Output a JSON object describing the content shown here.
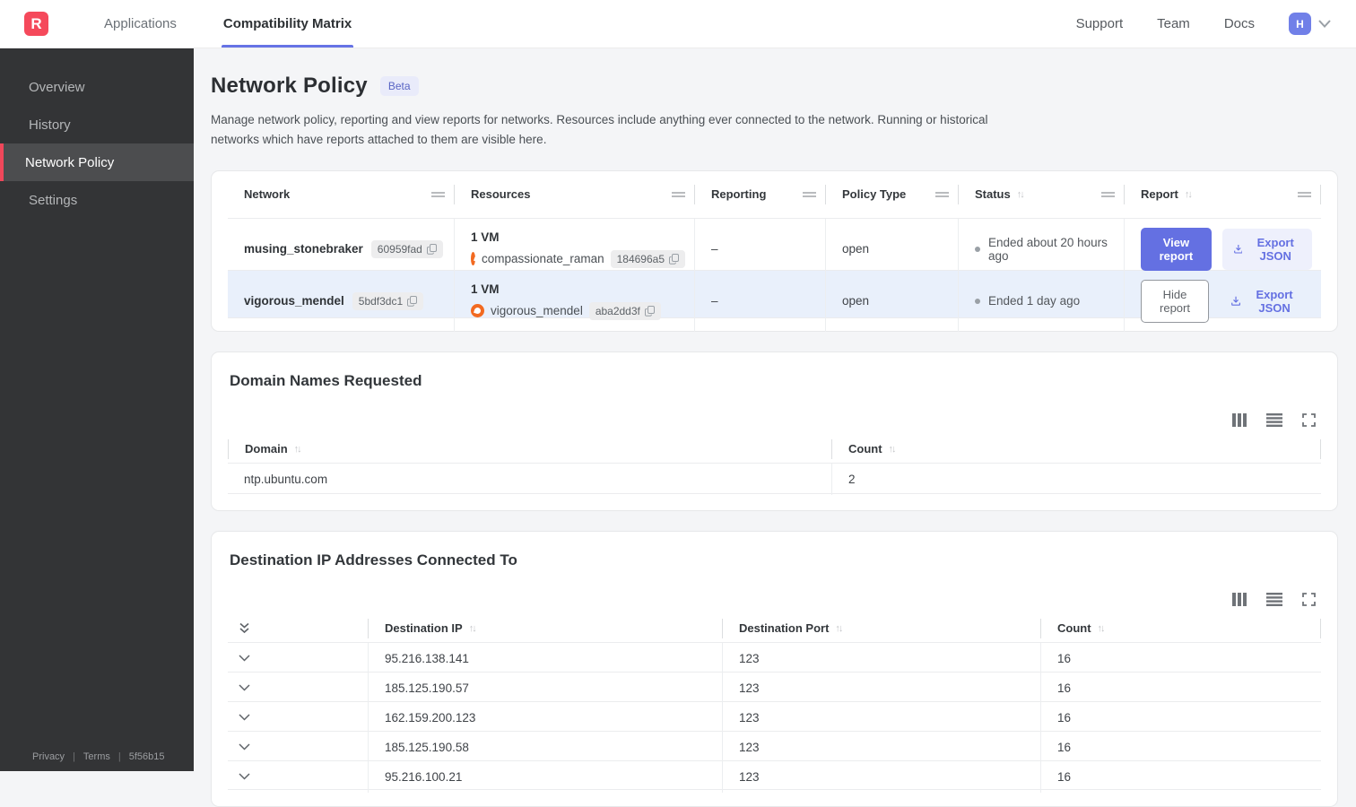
{
  "navbar": {
    "logo_letter": "R",
    "nav": [
      {
        "label": "Applications"
      },
      {
        "label": "Compatibility Matrix"
      }
    ],
    "links": {
      "support": "Support",
      "team": "Team",
      "docs": "Docs"
    },
    "avatar_initial": "H"
  },
  "sidebar": {
    "items": [
      {
        "label": "Overview"
      },
      {
        "label": "History"
      },
      {
        "label": "Network Policy"
      },
      {
        "label": "Settings"
      }
    ],
    "footer": {
      "privacy": "Privacy",
      "terms": "Terms",
      "version": "5f56b15"
    }
  },
  "page": {
    "title": "Network Policy",
    "beta_badge": "Beta",
    "description": "Manage network policy, reporting and view reports for networks. Resources include anything ever connected to the network. Running or historical networks which have reports attached to them are visible here."
  },
  "networks_table": {
    "columns": {
      "network": "Network",
      "resources": "Resources",
      "reporting": "Reporting",
      "policy_type": "Policy Type",
      "status": "Status",
      "report": "Report"
    },
    "rows": [
      {
        "network_name": "musing_stonebraker",
        "network_id": "60959fad",
        "resources_summary": "1 VM",
        "resource_name": "compassionate_raman",
        "resource_id": "184696a5",
        "reporting": "–",
        "policy_type": "open",
        "status": "Ended about 20 hours ago",
        "report_button": "View report",
        "export_label": "Export JSON"
      },
      {
        "network_name": "vigorous_mendel",
        "network_id": "5bdf3dc1",
        "resources_summary": "1 VM",
        "resource_name": "vigorous_mendel",
        "resource_id": "aba2dd3f",
        "reporting": "–",
        "policy_type": "open",
        "status": "Ended 1 day ago",
        "report_button": "Hide report",
        "export_label": "Export JSON"
      }
    ]
  },
  "domains_card": {
    "title": "Domain Names Requested",
    "columns": {
      "domain": "Domain",
      "count": "Count"
    },
    "rows": [
      {
        "domain": "ntp.ubuntu.com",
        "count": "2"
      }
    ]
  },
  "destinations_card": {
    "title": "Destination IP Addresses Connected To",
    "columns": {
      "ip": "Destination IP",
      "port": "Destination Port",
      "count": "Count"
    },
    "rows": [
      {
        "ip": "95.216.138.141",
        "port": "123",
        "count": "16"
      },
      {
        "ip": "185.125.190.57",
        "port": "123",
        "count": "16"
      },
      {
        "ip": "162.159.200.123",
        "port": "123",
        "count": "16"
      },
      {
        "ip": "185.125.190.58",
        "port": "123",
        "count": "16"
      },
      {
        "ip": "95.216.100.21",
        "port": "123",
        "count": "16"
      }
    ]
  },
  "colors": {
    "accent_indigo": "#6470e2",
    "brand_red": "#f5495b",
    "selected_row": "#e9f0fb",
    "sidebar_bg": "#333436",
    "resource_icon_orange": "#f26a21"
  }
}
